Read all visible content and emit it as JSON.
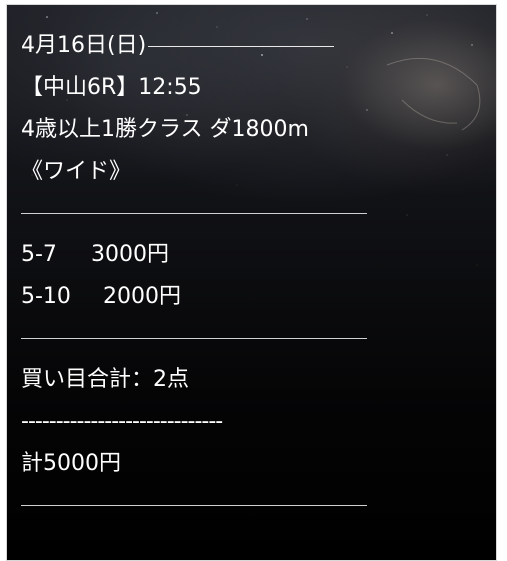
{
  "post": {
    "date": "4月16日(日)",
    "race": "【中山6R】12:55",
    "conditions": "4歳以上1勝クラス ダ1800m",
    "bet_type": "《ワイド》",
    "bets": [
      {
        "combo": "5-7",
        "amount": "3000円"
      },
      {
        "combo": "5-10",
        "amount": "2000円"
      }
    ],
    "total_points": "買い目合計：2点",
    "dashes": "-----------------------------",
    "total_amount": "計5000円"
  },
  "colors": {
    "text": "#ffffff",
    "rule": "#d0d0d0",
    "background_top": "#1e2026",
    "background_bottom": "#000000",
    "border": "#d8d8d8"
  }
}
